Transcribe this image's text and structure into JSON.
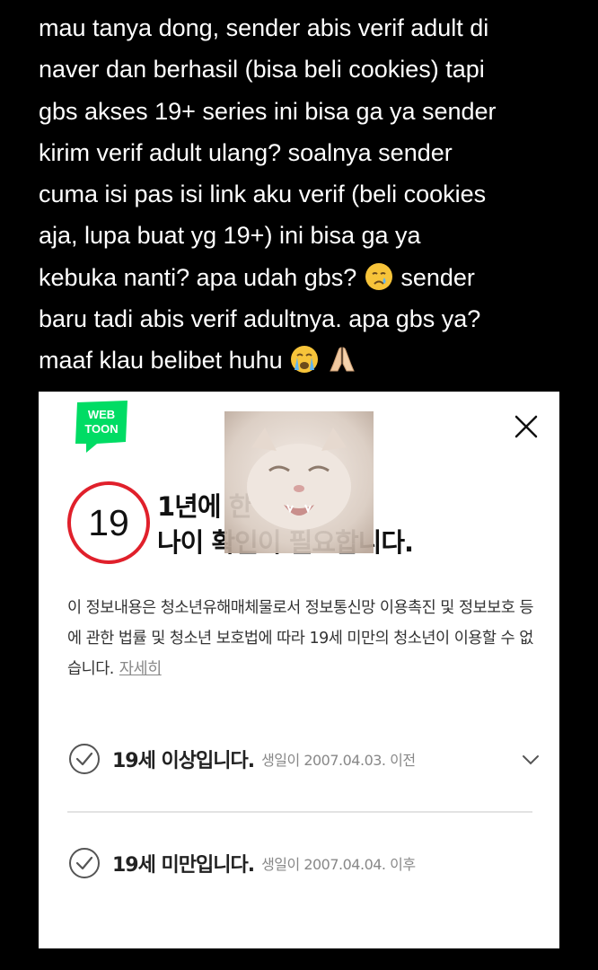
{
  "post": {
    "lines": [
      "mau tanya dong, sender abis verif adult di",
      "naver dan berhasil (bisa beli cookies) tapi",
      "gbs akses 19+ series ini bisa ga ya sender",
      "kirim verif adult ulang? soalnya sender",
      "cuma isi pas isi link aku verif (beli cookies",
      "aja, lupa buat yg 19+) ini bisa ga ya",
      "kebuka nanti? apa udah gbs?",
      "sender",
      "baru tadi abis verif adultnya. apa gbs ya?",
      "maaf klau belibet huhu"
    ],
    "emojis": [
      "crying-face",
      "loudly-crying-face",
      "folded-hands"
    ]
  },
  "card": {
    "logo_top": "WEB",
    "logo_bottom": "TOON",
    "badge": "19",
    "title_line1": "1년에 한 번,",
    "title_line2": "나이 확인이 필요합니다.",
    "description": "이 정보내용은 청소년유해매체물로서 정보통신망 이용촉진 및 정보보호 등에 관한 법률 및 청소년 보호법에 따라 19세 미만의 청소년이 이용할 수 없습니다.",
    "more_link": "자세히",
    "options": [
      {
        "label": "19세 이상입니다.",
        "sub": "생일이 2007.04.03. 이전"
      },
      {
        "label": "19세 미만입니다.",
        "sub": "생일이 2007.04.04. 이후"
      }
    ]
  },
  "colors": {
    "background": "#000000",
    "brand_green": "#00dc64",
    "badge_red": "#e0202b"
  }
}
